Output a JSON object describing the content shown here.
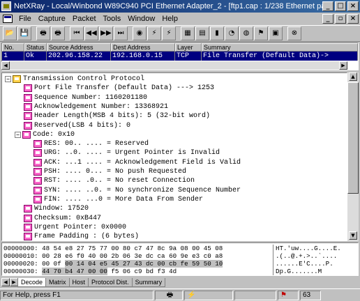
{
  "window": {
    "title": "NetXRay - Local/Winbond W89C940 PCI Ethernet Adapter_2 - [ftp1.cap : 1/238 Ethernet packets]",
    "controls": [
      "_",
      "□",
      "×"
    ]
  },
  "menu": {
    "items": [
      "File",
      "Capture",
      "Packet",
      "Tools",
      "Window",
      "Help"
    ],
    "doc_controls": [
      "_",
      "▫",
      "×"
    ]
  },
  "toolbar": {
    "buttons": [
      {
        "name": "open-icon",
        "glyph": "📂"
      },
      {
        "name": "save-icon",
        "glyph": "💾"
      },
      {
        "name": "print-icon",
        "glyph": "🖶"
      },
      {
        "name": "print-preview-icon",
        "glyph": "🖶"
      },
      {
        "name": "first-packet-icon",
        "glyph": "⏮"
      },
      {
        "name": "previous-packet-icon",
        "glyph": "◀◀"
      },
      {
        "name": "next-packet-icon",
        "glyph": "▶▶"
      },
      {
        "name": "last-packet-icon",
        "glyph": "⏭"
      },
      {
        "name": "capture-icon",
        "glyph": "◉"
      },
      {
        "name": "decode-icon",
        "glyph": "⚡"
      },
      {
        "name": "filter-icon",
        "glyph": "⚡"
      },
      {
        "name": "matrix-icon",
        "glyph": "▦"
      },
      {
        "name": "host-table-icon",
        "glyph": "▤"
      },
      {
        "name": "bar-chart-icon",
        "glyph": "▮"
      },
      {
        "name": "pie-chart-icon",
        "glyph": "◔"
      },
      {
        "name": "protocol-icon",
        "glyph": "◍"
      },
      {
        "name": "alarm-icon",
        "glyph": "⚑"
      },
      {
        "name": "history-icon",
        "glyph": "▣"
      },
      {
        "name": "stop-icon",
        "glyph": "⊗"
      }
    ]
  },
  "packet_list": {
    "columns": [
      "No.",
      "Status",
      "Source Address",
      "Dest Address",
      "Layer",
      "Summary"
    ],
    "rows": [
      {
        "no": "1",
        "status": "Ok",
        "source": "202.96.158.22",
        "dest": "192.168.0.15",
        "layer": "TCP",
        "summary": "File Transfer (Default Data)->"
      }
    ]
  },
  "decode_tree": [
    {
      "text": "Transmission Control Protocol",
      "expander": "−",
      "icon": "folder",
      "indent": 0
    },
    {
      "text": "Port File Transfer (Default Data) ---> 1253",
      "expander": "",
      "icon": "field",
      "indent": 1
    },
    {
      "text": "Sequence Number: 1160201180",
      "expander": "",
      "icon": "field",
      "indent": 1
    },
    {
      "text": "Acknowledgement Number: 13368921",
      "expander": "",
      "icon": "field",
      "indent": 1
    },
    {
      "text": "Header Length(MSB 4 bits): 5 (32-bit word)",
      "expander": "",
      "icon": "field",
      "indent": 1
    },
    {
      "text": "Reserved(LSB 4 bits): 0",
      "expander": "",
      "icon": "field",
      "indent": 1
    },
    {
      "text": "Code: 0x10",
      "expander": "−",
      "icon": "field",
      "indent": 1
    },
    {
      "text": "RES: 00.. .... = Reserved",
      "expander": "",
      "icon": "field",
      "indent": 2
    },
    {
      "text": "URG: ..0. .... = Urgent Pointer is Invalid",
      "expander": "",
      "icon": "field",
      "indent": 2
    },
    {
      "text": "ACK: ...1 .... = Acknowledgement Field is Valid",
      "expander": "",
      "icon": "field",
      "indent": 2
    },
    {
      "text": "PSH: .... 0... = No push Requested",
      "expander": "",
      "icon": "field",
      "indent": 2
    },
    {
      "text": "RST: .... .0.. = No reset Connection",
      "expander": "",
      "icon": "field",
      "indent": 2
    },
    {
      "text": "SYN: .... ..0. = No synchronize Sequence Number",
      "expander": "",
      "icon": "field",
      "indent": 2
    },
    {
      "text": "FIN: .... ...0 = More Data From Sender",
      "expander": "",
      "icon": "field",
      "indent": 2
    },
    {
      "text": "Window: 17520",
      "expander": "",
      "icon": "field",
      "indent": 1
    },
    {
      "text": "Checksum: 0xB447",
      "expander": "",
      "icon": "field",
      "indent": 1
    },
    {
      "text": "Urgent Pointer: 0x0000",
      "expander": "",
      "icon": "field",
      "indent": 1
    },
    {
      "text": "Frame Padding : (6 bytes)",
      "expander": "",
      "icon": "field",
      "indent": 1
    }
  ],
  "hex_dump": [
    {
      "hex_pre": "00000000: 48 54 e8 27 75 77 00 80 c7 47 8c 9a 08 00 45 08",
      "hex_hl": "",
      "hex_post": "",
      "ascii": "HT.'uw....G....E."
    },
    {
      "hex_pre": "00000010: 00 28 e6 f0 40 00 2b 06 3e dc ca 60 9e e3 c0 a8",
      "hex_hl": "",
      "hex_post": "",
      "ascii": ".(..@.+.>..`...."
    },
    {
      "hex_pre": "00000020: 00 0f ",
      "hex_hl": "00 14 04 e5 45 27 43 dc 00 cb fe 59 50 10",
      "hex_post": "",
      "ascii": "......E'C....P."
    },
    {
      "hex_pre": "00000030: ",
      "hex_hl": "44 70 b4 47 00 00",
      "hex_post": " f5 06 c9 bd f3 4d",
      "ascii": "Dp.G.......M"
    }
  ],
  "tabs": [
    "Decode",
    "Matrix",
    "Host",
    "Protocol Dist.",
    "Summary"
  ],
  "active_tab": "Decode",
  "status": {
    "help_text": "For Help, press F1",
    "counter": "63"
  },
  "colors": {
    "selection": "#000080",
    "title_start": "#0a246a",
    "field_icon": "#ff66cc",
    "folder_icon": "#ffd24a"
  }
}
